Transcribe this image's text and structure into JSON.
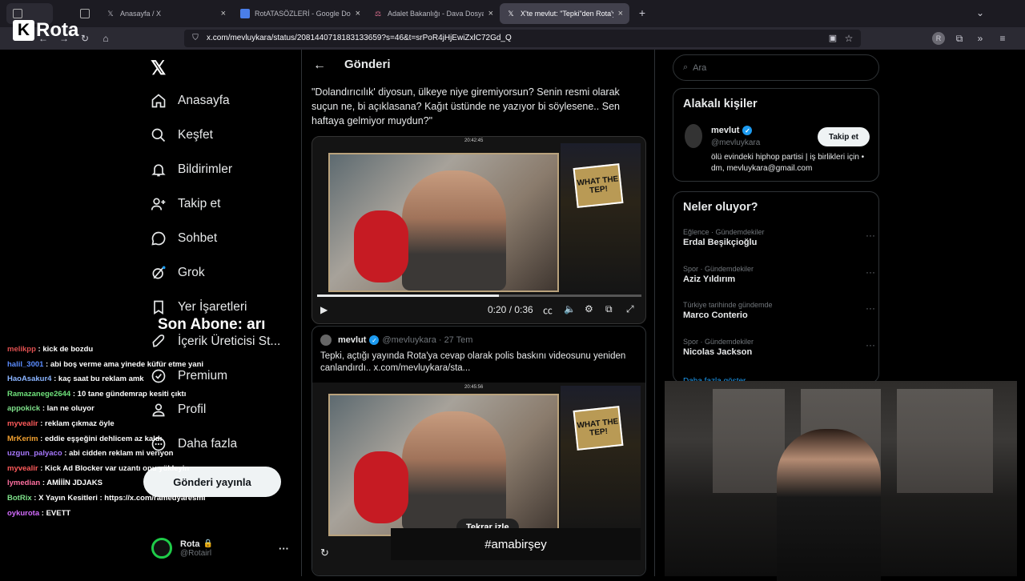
{
  "browser": {
    "tabs": [
      {
        "label": "",
        "favicon": "pinned-icon"
      },
      {
        "label": "",
        "favicon": "tab-overview-icon"
      },
      {
        "label": "Anasayfa / X",
        "favicon": "x-icon"
      },
      {
        "label": "RotATASÖZLERİ - Google Dokü",
        "favicon": "docs-icon"
      },
      {
        "label": "Adalet Bakanlığı - Dava Dosyası",
        "favicon": "scale-icon"
      },
      {
        "label": "X'te mevlut: \"Tepki\"den Rota'ya",
        "favicon": "x-icon"
      }
    ],
    "url": "x.com/mevluykara/status/2081440718183133659?s=46&t=srPoR4jHjEwiZxlC72Gd_Q"
  },
  "overlay": {
    "logo_letter": "K",
    "logo_text": "Rota",
    "son_abone": "Son Abone: arı",
    "hashtag": "#amabirşey"
  },
  "sidebar": {
    "items": [
      {
        "label": "Anasayfa",
        "icon": "home-icon"
      },
      {
        "label": "Keşfet",
        "icon": "search-icon"
      },
      {
        "label": "Bildirimler",
        "icon": "bell-icon"
      },
      {
        "label": "Takip et",
        "icon": "add-user-icon"
      },
      {
        "label": "Sohbet",
        "icon": "chat-icon"
      },
      {
        "label": "Grok",
        "icon": "grok-icon"
      },
      {
        "label": "Yer İşaretleri",
        "icon": "bookmark-icon"
      },
      {
        "label": "İçerik Üreticisi St...",
        "icon": "rocket-icon"
      },
      {
        "label": "Premium",
        "icon": "premium-icon"
      },
      {
        "label": "Profil",
        "icon": "profile-icon"
      },
      {
        "label": "Daha fazla",
        "icon": "more-icon"
      }
    ],
    "post_button": "Gönderi yayınla",
    "user_name": "Rota",
    "user_handle": "@Rotairl",
    "user_more": "···"
  },
  "post": {
    "back": "←",
    "title": "Gönderi",
    "text": "\"Dolandırıcılık' diyosun, ülkeye niye giremiyorsun? Senin resmi olarak suçun ne, bi açıklasana? Kağıt üstünde ne yazıyor bi söylesene.. Sen haftaya gelmiyor muydun?\"",
    "video_time": "0:20 / 0:36",
    "video_progress": 0.56,
    "video_stamp": "20:42:45",
    "quote_name": "mevlut",
    "quote_handle": "@mevluykara",
    "quote_date": "27 Tem",
    "quote_text": "Tepki, açtığı yayında Rota'ya cevap olarak polis baskını videosunu yeniden canlandırdı..  x.com/mevluykara/sta...",
    "quote_stamp": "20:45:56",
    "replay_label": "Tekrar izle",
    "thumb_text": "WHAT THE TEP!"
  },
  "right": {
    "search_placeholder": "Ara",
    "related_title": "Alakalı kişiler",
    "person_name": "mevlut",
    "person_handle": "@mevluykara",
    "person_bio": "ölü evindeki hiphop partisi | iş birlikleri için • dm, mevluykara@gmail.com",
    "follow_label": "Takip et",
    "trends_title": "Neler oluyor?",
    "trends": [
      {
        "meta": "Eğlence · Gündemdekiler",
        "name": "Erdal Beşikçioğlu"
      },
      {
        "meta": "Spor · Gündemdekiler",
        "name": "Aziz Yıldırım"
      },
      {
        "meta": "Türkiye tarihinde gündemde",
        "name": "Marco Conterio"
      },
      {
        "meta": "Spor · Gündemdekiler",
        "name": "Nicolas Jackson"
      }
    ],
    "show_more": "Daha fazla göster"
  },
  "chat": [
    {
      "user": "melikpp",
      "color": "#e05050",
      "msg": "kick de bozdu"
    },
    {
      "user": "halil_3001",
      "color": "#5a8cff",
      "msg": "abi boş verme ama yinede küfür etme yani"
    },
    {
      "user": "HaoAsakur4",
      "color": "#8ab4ff",
      "msg": "kaç saat bu reklam amk"
    },
    {
      "user": "Ramazanege2644",
      "color": "#6ee07a",
      "msg": "10 tane gündemrap kesiti çıktı"
    },
    {
      "user": "appokick",
      "color": "#7ee08a",
      "msg": "lan ne oluyor"
    },
    {
      "user": "myvealir",
      "color": "#ff5b5b",
      "msg": "reklam çıkmaz öyle"
    },
    {
      "user": "MrKerim",
      "color": "#f0a030",
      "msg": "eddie eşşeğini dehlicem az kaldı"
    },
    {
      "user": "uzgun_palyaco",
      "color": "#a878ff",
      "msg": "abi cidden reklam mi veriyon"
    },
    {
      "user": "myvealir",
      "color": "#ff5b5b",
      "msg": "Kick Ad Blocker var uzantı onu yükleyin"
    },
    {
      "user": "lymedian",
      "color": "#ff6fa0",
      "msg": "AMİİİN JDJAKS"
    },
    {
      "user": "BotRix",
      "color": "#7ee08a",
      "msg": "X Yayın Kesitleri : https://x.com/ramedyaresmi"
    },
    {
      "user": "oykurota",
      "color": "#d36cff",
      "msg": "EVETT"
    }
  ],
  "colors": {
    "accent": "#1d9bf0",
    "verified": "#1d9bf0",
    "background": "#000000"
  }
}
